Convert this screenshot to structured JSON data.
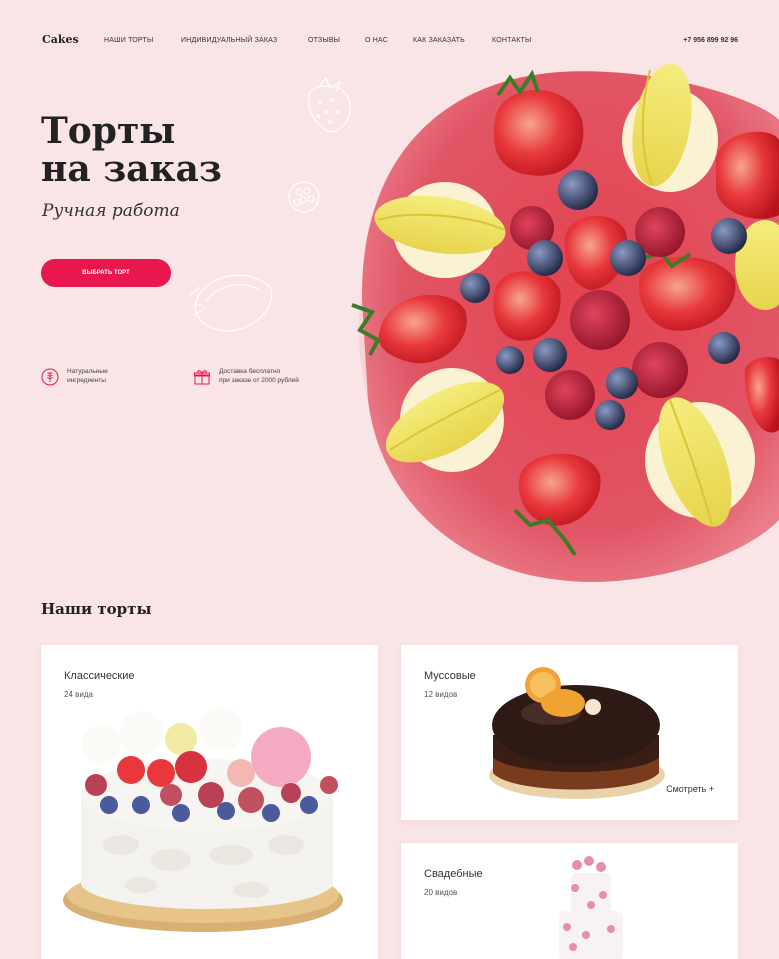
{
  "header": {
    "logo": "Cakes",
    "nav": [
      "Наши торты",
      "Индивидуальный заказ",
      "Отзывы",
      "О нас",
      "Как заказать",
      "Контакты"
    ],
    "phone": "+7 956 899 92 96"
  },
  "hero": {
    "title_line1": "Торты",
    "title_line2": "на заказ",
    "subtitle": "Ручная работа",
    "cta_label": "Выбрать торт",
    "features": [
      {
        "icon": "wheat-icon",
        "text_line1": "Натуральные",
        "text_line2": "ингредиенты"
      },
      {
        "icon": "gift-icon",
        "text_line1": "Доставка бесплатно",
        "text_line2": "при заказе от 2000 рублей"
      }
    ]
  },
  "catalog": {
    "title": "Наши торты",
    "cards": [
      {
        "title": "Классические",
        "count": "24 вида"
      },
      {
        "title": "Муссовые",
        "count": "12 видов",
        "more": "Смотреть +"
      },
      {
        "title": "Свадебные",
        "count": "20 видов"
      }
    ]
  },
  "colors": {
    "background": "#f9e4e6",
    "accent": "#e8174e",
    "glaze": "#e55a6b",
    "macaron": "#f0e26a"
  }
}
